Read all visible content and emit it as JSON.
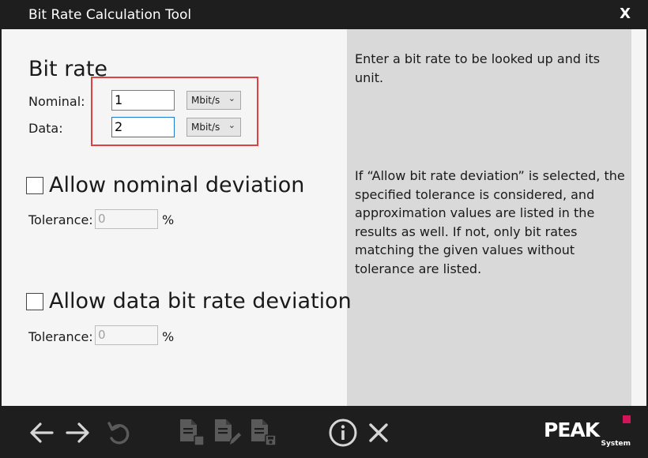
{
  "window": {
    "title": "Bit Rate Calculation Tool",
    "close_label": "X"
  },
  "bit_rate": {
    "section_title": "Bit rate",
    "nominal": {
      "label": "Nominal:",
      "value": "1",
      "unit": "Mbit/s"
    },
    "data": {
      "label": "Data:",
      "value": "2",
      "unit": "Mbit/s"
    }
  },
  "nominal_deviation": {
    "checked": false,
    "label": "Allow nominal deviation",
    "tolerance_label": "Tolerance:",
    "tolerance_value": "0",
    "percent": "%"
  },
  "data_deviation": {
    "checked": false,
    "label": "Allow data bit rate deviation",
    "tolerance_label": "Tolerance:",
    "tolerance_value": "0",
    "percent": "%"
  },
  "help": {
    "bit_rate_text": "Enter a bit rate to be looked up and its unit.",
    "deviation_text": "If “Allow bit rate deviation” is selected, the specified tolerance is considered, and approximation values are listed in the results as well. If not, only bit rates matching the given values without tolerance are listed."
  },
  "toolbar": {
    "icons": [
      "arrow-left-icon",
      "arrow-right-icon",
      "undo-icon",
      "document-copy-icon",
      "document-edit-icon",
      "document-save-icon",
      "info-icon",
      "close-icon"
    ]
  },
  "branding": {
    "logo_text": "PEAK",
    "logo_sub": "System",
    "accent_color": "#d4145a"
  },
  "colors": {
    "dark_bar": "#1e1e1e",
    "left_pane": "#f5f5f5",
    "right_pane": "#d9d9d9",
    "highlight": "#e04040",
    "focus": "#1c7ad1"
  }
}
